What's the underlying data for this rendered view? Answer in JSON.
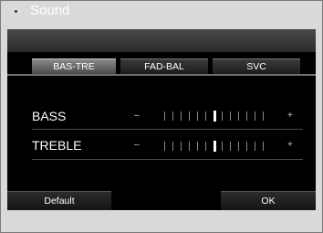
{
  "header": {
    "title": "Sound",
    "icon": "gear-icon"
  },
  "tabs": [
    {
      "label": "BAS-TRE",
      "active": true
    },
    {
      "label": "FAD-BAL",
      "active": false
    },
    {
      "label": "SVC",
      "active": false
    }
  ],
  "settings": [
    {
      "label": "BASS",
      "minus": "–",
      "plus": "+",
      "level": 0
    },
    {
      "label": "TREBLE",
      "minus": "–",
      "plus": "+",
      "level": 0
    }
  ],
  "footer": {
    "default_label": "Default",
    "ok_label": "OK"
  }
}
